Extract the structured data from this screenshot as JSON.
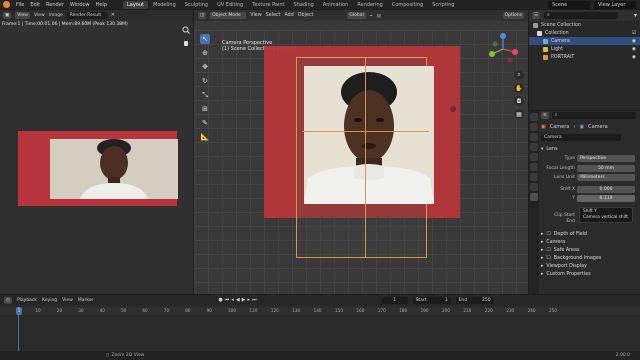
{
  "topbar": {
    "menus": [
      "File",
      "Edit",
      "Render",
      "Window",
      "Help"
    ],
    "workspaces": [
      "Layout",
      "Modeling",
      "Sculpting",
      "UV Editing",
      "Texture Paint",
      "Shading",
      "Animation",
      "Rendering",
      "Compositing",
      "Scripting"
    ],
    "active_workspace": "Layout",
    "scene": "Scene",
    "view_layer": "View Layer"
  },
  "image_editor": {
    "view": "View",
    "view_menu": "View",
    "image_menu": "Image",
    "image_name": "Render Result",
    "render_info": "Frame:1 | Time:00:01.06 | Mem:89.60M (Peak 130.38M)"
  },
  "viewport": {
    "mode": "Object Mode",
    "menus": [
      "View",
      "Select",
      "Add",
      "Object"
    ],
    "orientation": "Global",
    "options": "Options",
    "camera_title": "Camera Perspective",
    "camera_sub": "(1) Scene Collection | Camera"
  },
  "outliner": {
    "rows": [
      {
        "label": "Scene Collection",
        "selected": false,
        "color": "#9a9a9a"
      },
      {
        "label": "Collection",
        "selected": false,
        "color": "#d8d8d8"
      },
      {
        "label": "Camera",
        "selected": true,
        "color": "#67b0c6"
      },
      {
        "label": "Light",
        "selected": false,
        "color": "#e6b64a"
      },
      {
        "label": "PORTRAIT",
        "selected": false,
        "color": "#e0944a"
      }
    ]
  },
  "properties": {
    "breadcrumb_obj": "Camera",
    "breadcrumb_data": "Camera",
    "datablock": "Camera",
    "lens_panel": "Lens",
    "type_label": "Type",
    "type_value": "Perspective",
    "focal_label": "Focal Length",
    "focal_value": "50 mm",
    "lens_unit_label": "Lens Unit",
    "lens_unit_value": "Millimeters",
    "shiftx_label": "Shift X",
    "shiftx_value": "0.000",
    "shifty_label": "Y",
    "shifty_value": "0.110",
    "clip_start_label": "Clip Start",
    "clip_end_label": "End",
    "tooltip_title": "Shift Y",
    "tooltip_body": "Camera vertical shift.",
    "panels": [
      "Depth of Field",
      "Camera",
      "Safe Areas",
      "Background Images",
      "Viewport Display",
      "Custom Properties"
    ]
  },
  "timeline": {
    "menus": [
      "Playback",
      "Keying",
      "View",
      "Marker"
    ],
    "current_frame": "1",
    "start_label": "Start",
    "start_value": "1",
    "end_label": "End",
    "end_value": "250",
    "ticks": [
      "1",
      "10",
      "20",
      "30",
      "40",
      "50",
      "60",
      "70",
      "80",
      "90",
      "100",
      "110",
      "120",
      "130",
      "140",
      "150",
      "160",
      "170",
      "180",
      "190",
      "200",
      "210",
      "220",
      "230",
      "240",
      "250"
    ]
  },
  "statusbar": {
    "hint": "Zoom 2D View",
    "version": "2.90.0"
  },
  "colors": {
    "accent": "#4772b3",
    "frame_red": "#ba363a",
    "selection": "#334d80"
  }
}
